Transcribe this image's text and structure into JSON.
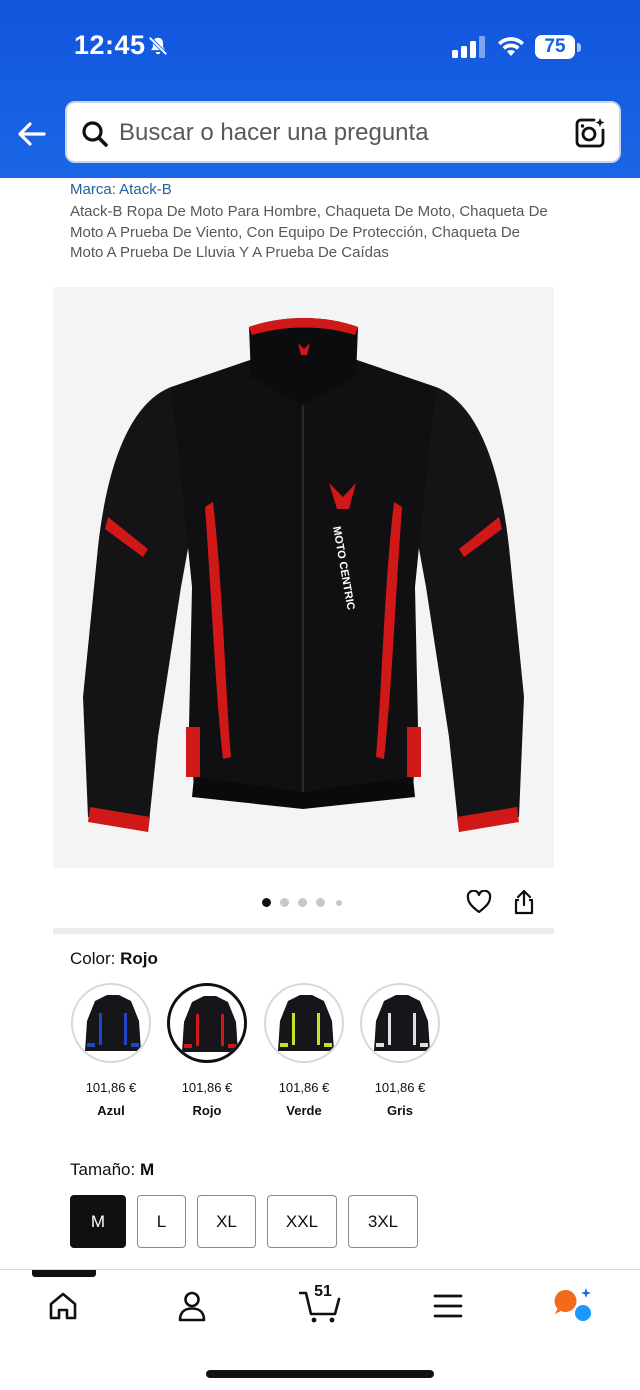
{
  "status_bar": {
    "time": "12:45",
    "battery": "75"
  },
  "search": {
    "placeholder": "Buscar o hacer una pregunta"
  },
  "product": {
    "brand": "Marca: Atack-B",
    "title": "Atack-B Ropa De Moto Para Hombre, Chaqueta De Moto, Chaqueta De Moto A Prueba De Viento, Con Equipo De Protección, Chaqueta De Moto A Prueba De Lluvia Y A Prueba De Caídas",
    "image_count": 5,
    "active_image_index": 0
  },
  "color_section": {
    "label": "Color: ",
    "selected": "Rojo",
    "options": [
      {
        "name": "Azul",
        "price": "101,86 €",
        "accent": "#1d46c8"
      },
      {
        "name": "Rojo",
        "price": "101,86 €",
        "accent": "#d01818"
      },
      {
        "name": "Verde",
        "price": "101,86 €",
        "accent": "#c6e12a"
      },
      {
        "name": "Gris",
        "price": "101,86 €",
        "accent": "#e0e0e0"
      }
    ]
  },
  "size_section": {
    "label": "Tamaño: ",
    "selected": "M",
    "options": [
      "M",
      "L",
      "XL",
      "XXL",
      "3XL"
    ]
  },
  "bottom_nav": {
    "cart_count": "51",
    "items": [
      "home-icon",
      "account-icon",
      "cart-icon",
      "menu-icon",
      "rufus-ai-icon"
    ]
  },
  "colors": {
    "header_blue": "#1a66e6",
    "link_blue": "#2162a1",
    "accent_red": "#d01818"
  }
}
